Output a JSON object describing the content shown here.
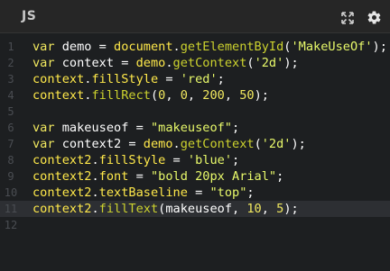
{
  "header": {
    "language_label": "JS",
    "expand_icon": "expand-icon",
    "settings_icon": "gear-icon"
  },
  "colors": {
    "background": "#1d1f21",
    "header_background": "#262626",
    "keyword": "#f1e85f",
    "string": "#e8f96a",
    "method": "#ccd22e",
    "line_number": "#4a4d52",
    "active_line": "#2d2f33"
  },
  "editor": {
    "active_line": 11,
    "lines": [
      {
        "number": "1",
        "tokens": [
          {
            "t": "kw",
            "v": "var"
          },
          {
            "t": "op",
            "v": " demo = "
          },
          {
            "t": "ident",
            "v": "document"
          },
          {
            "t": "op",
            "v": "."
          },
          {
            "t": "method",
            "v": "getElementById"
          },
          {
            "t": "op",
            "v": "("
          },
          {
            "t": "str",
            "v": "'MakeUseOf'"
          },
          {
            "t": "op",
            "v": ");"
          }
        ]
      },
      {
        "number": "2",
        "tokens": [
          {
            "t": "kw",
            "v": "var"
          },
          {
            "t": "op",
            "v": " context = "
          },
          {
            "t": "ident",
            "v": "demo"
          },
          {
            "t": "op",
            "v": "."
          },
          {
            "t": "method",
            "v": "getContext"
          },
          {
            "t": "op",
            "v": "("
          },
          {
            "t": "str",
            "v": "'2d'"
          },
          {
            "t": "op",
            "v": ");"
          }
        ]
      },
      {
        "number": "3",
        "tokens": [
          {
            "t": "ident",
            "v": "context"
          },
          {
            "t": "op",
            "v": "."
          },
          {
            "t": "prop",
            "v": "fillStyle"
          },
          {
            "t": "op",
            "v": " = "
          },
          {
            "t": "str",
            "v": "'red'"
          },
          {
            "t": "op",
            "v": ";"
          }
        ]
      },
      {
        "number": "4",
        "tokens": [
          {
            "t": "ident",
            "v": "context"
          },
          {
            "t": "op",
            "v": "."
          },
          {
            "t": "method",
            "v": "fillRect"
          },
          {
            "t": "op",
            "v": "("
          },
          {
            "t": "num",
            "v": "0"
          },
          {
            "t": "op",
            "v": ", "
          },
          {
            "t": "num",
            "v": "0"
          },
          {
            "t": "op",
            "v": ", "
          },
          {
            "t": "num",
            "v": "200"
          },
          {
            "t": "op",
            "v": ", "
          },
          {
            "t": "num",
            "v": "50"
          },
          {
            "t": "op",
            "v": ");"
          }
        ]
      },
      {
        "number": "5",
        "tokens": []
      },
      {
        "number": "6",
        "tokens": [
          {
            "t": "kw",
            "v": "var"
          },
          {
            "t": "op",
            "v": " makeuseof = "
          },
          {
            "t": "str",
            "v": "\"makeuseof\""
          },
          {
            "t": "op",
            "v": ";"
          }
        ]
      },
      {
        "number": "7",
        "tokens": [
          {
            "t": "kw",
            "v": "var"
          },
          {
            "t": "op",
            "v": " context2 = "
          },
          {
            "t": "ident",
            "v": "demo"
          },
          {
            "t": "op",
            "v": "."
          },
          {
            "t": "method",
            "v": "getContext"
          },
          {
            "t": "op",
            "v": "("
          },
          {
            "t": "str",
            "v": "'2d'"
          },
          {
            "t": "op",
            "v": ");"
          }
        ]
      },
      {
        "number": "8",
        "tokens": [
          {
            "t": "ident",
            "v": "context2"
          },
          {
            "t": "op",
            "v": "."
          },
          {
            "t": "prop",
            "v": "fillStyle"
          },
          {
            "t": "op",
            "v": " = "
          },
          {
            "t": "str",
            "v": "'blue'"
          },
          {
            "t": "op",
            "v": ";"
          }
        ]
      },
      {
        "number": "9",
        "tokens": [
          {
            "t": "ident",
            "v": "context2"
          },
          {
            "t": "op",
            "v": "."
          },
          {
            "t": "prop",
            "v": "font"
          },
          {
            "t": "op",
            "v": " = "
          },
          {
            "t": "str",
            "v": "\"bold 20px Arial\""
          },
          {
            "t": "op",
            "v": ";"
          }
        ]
      },
      {
        "number": "10",
        "tokens": [
          {
            "t": "ident",
            "v": "context2"
          },
          {
            "t": "op",
            "v": "."
          },
          {
            "t": "prop",
            "v": "textBaseline"
          },
          {
            "t": "op",
            "v": " = "
          },
          {
            "t": "str",
            "v": "\"top\""
          },
          {
            "t": "op",
            "v": ";"
          }
        ]
      },
      {
        "number": "11",
        "tokens": [
          {
            "t": "ident",
            "v": "context2"
          },
          {
            "t": "op",
            "v": "."
          },
          {
            "t": "method",
            "v": "fillText"
          },
          {
            "t": "op",
            "v": "(makeuseof, "
          },
          {
            "t": "num",
            "v": "10"
          },
          {
            "t": "op",
            "v": ", "
          },
          {
            "t": "num",
            "v": "5"
          },
          {
            "t": "op",
            "v": ");"
          }
        ]
      },
      {
        "number": "12",
        "tokens": []
      }
    ]
  }
}
